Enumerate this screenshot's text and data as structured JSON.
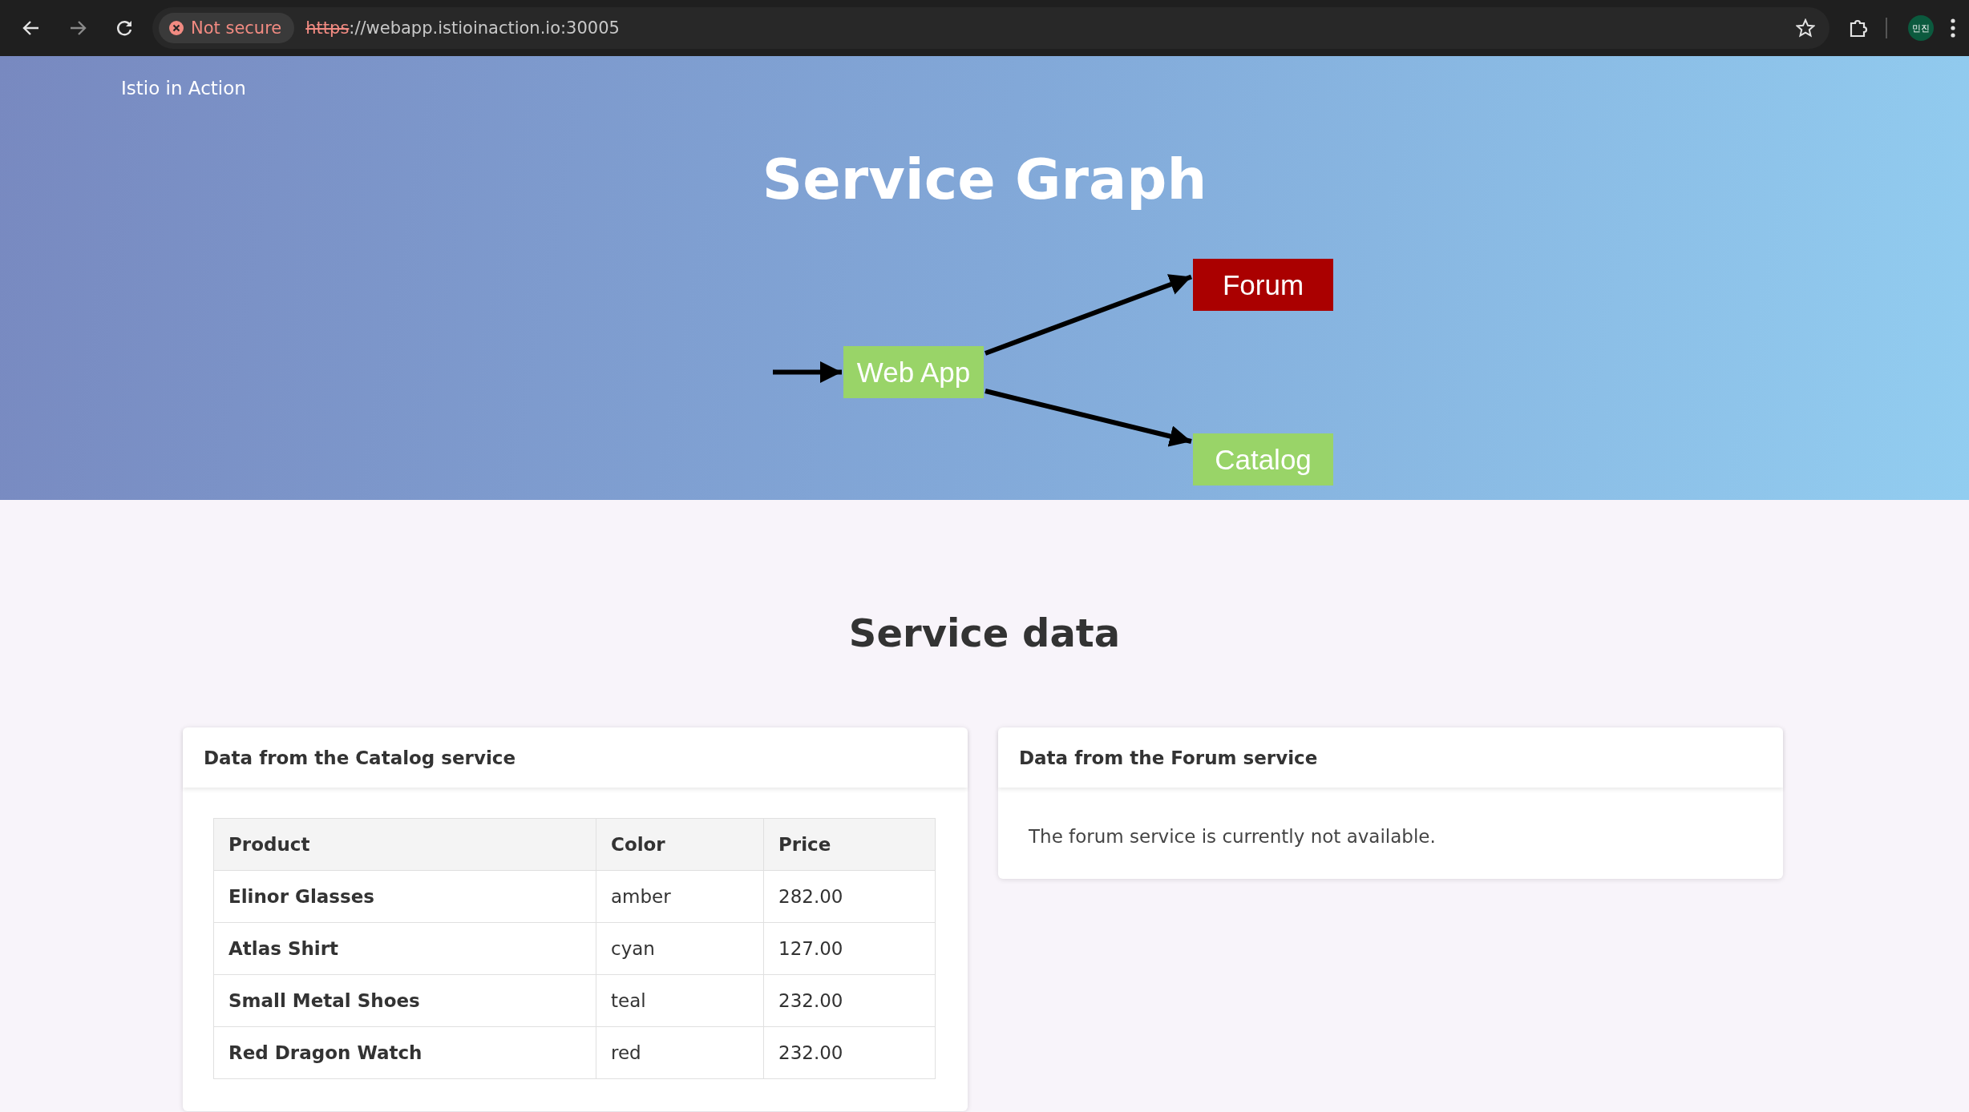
{
  "browser": {
    "security": "Not secure",
    "url_scheme": "https",
    "url_rest": "://webapp.istioinaction.io:30005",
    "profile": "민진"
  },
  "hero": {
    "brand": "Istio in Action",
    "title": "Service Graph",
    "nodes": [
      {
        "kind": "entry",
        "label": "Web App",
        "color": "#99d468"
      },
      {
        "kind": "backend",
        "label": "Forum",
        "color": "#aa0000"
      },
      {
        "kind": "backend",
        "label": "Catalog",
        "color": "#99d468"
      }
    ]
  },
  "section_title": "Service data",
  "cards": [
    {
      "kind": "table",
      "title": "Data from the Catalog service",
      "columns": [
        "Product",
        "Color",
        "Price"
      ],
      "rows": [
        [
          "Elinor Glasses",
          "amber",
          "282.00"
        ],
        [
          "Atlas Shirt",
          "cyan",
          "127.00"
        ],
        [
          "Small Metal Shoes",
          "teal",
          "232.00"
        ],
        [
          "Red Dragon Watch",
          "red",
          "232.00"
        ]
      ]
    },
    {
      "kind": "message",
      "title": "Data from the Forum service",
      "message": "The forum service is currently not available."
    }
  ]
}
